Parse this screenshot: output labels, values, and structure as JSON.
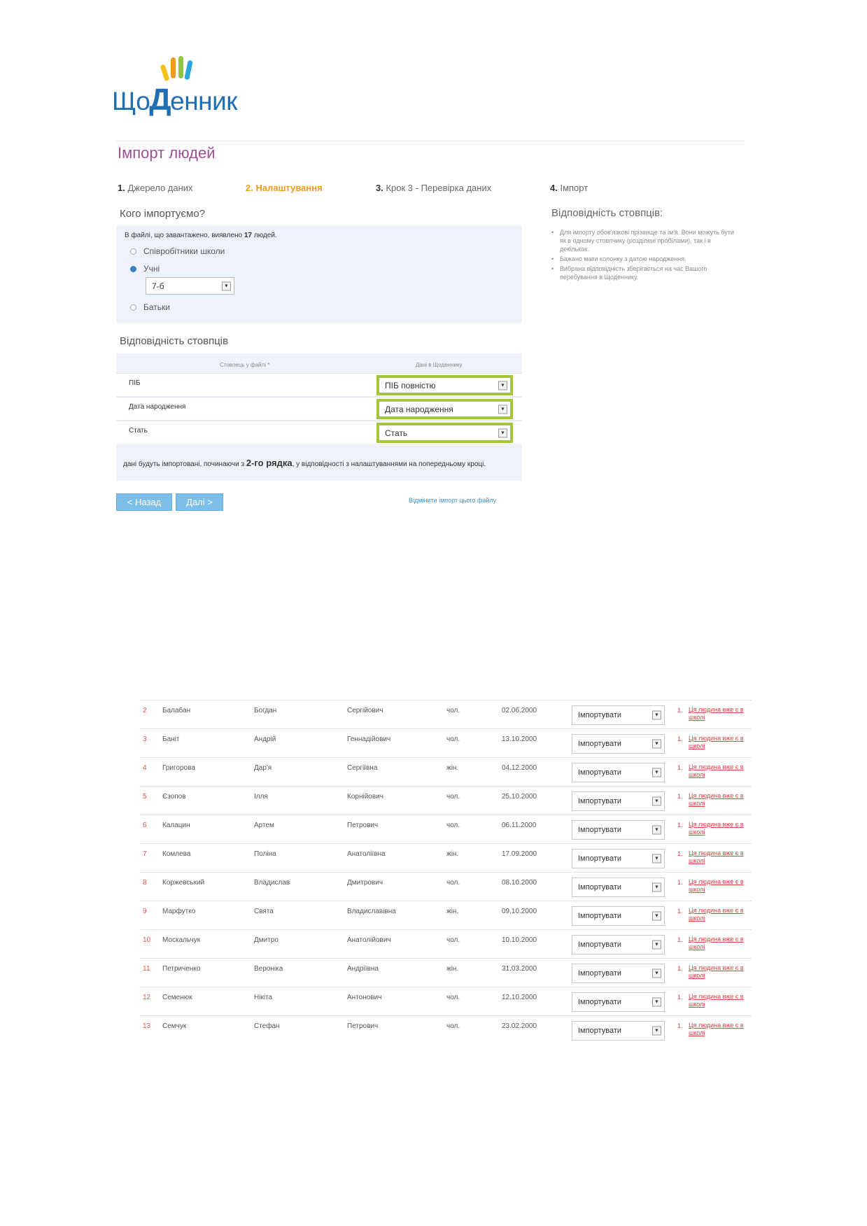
{
  "logo": {
    "prefix": "Що",
    "letter": "Д",
    "suffix": "енник"
  },
  "page_title": "Імпорт людей",
  "steps": [
    {
      "num": "1.",
      "label": "Джерело даних"
    },
    {
      "num": "2.",
      "label": "Налаштування"
    },
    {
      "num": "3.",
      "label": "Крок 3 - Перевірка даних"
    },
    {
      "num": "4.",
      "label": "Імпорт"
    }
  ],
  "who": {
    "title": "Кого імпортуємо?",
    "found_prefix": "В файлі, що завантажено, виявлено",
    "found_count": "17",
    "found_suffix": "людей.",
    "options": [
      "Співробітники школи",
      "Учні",
      "Батьки"
    ],
    "class_select": "7-б"
  },
  "mapping": {
    "title": "Відповідність стовпців",
    "col_file": "Стовпець у файлі *",
    "col_target": "Дані в Щоденнику",
    "rows": [
      {
        "file": "ПІБ",
        "target": "ПІБ повністю"
      },
      {
        "file": "Дата народження",
        "target": "Дата народження"
      },
      {
        "file": "Стать",
        "target": "Стать"
      }
    ],
    "note_prefix": "дані будуть імпортовані, починаючи з",
    "note_row": "2-го рядка",
    "note_suffix": ", у відповідності з налаштуваннями на попередньому кроці."
  },
  "buttons": {
    "back": "< Назад",
    "next": "Далі >"
  },
  "cancel_link": "Відмінити імпорт цього файлу",
  "side": {
    "title": "Відповідність стовпців:",
    "items": [
      "Для імпорту обов'язкові прізвище та ім'я. Вони можуть бути як в одному стовпчику (розділені пробілами), так і в декількох.",
      "Бажано мати колонку з датою народження.",
      "Вибрана відповідність зберігається на час Вашого перебування в Щоденнику."
    ]
  },
  "table": {
    "action": "Імпортувати",
    "error_num": "1.",
    "error_text": "Ця людина вже є в школі",
    "rows": [
      {
        "idx": "2",
        "last": "Балабан",
        "first": "Богдан",
        "middle": "Сергійович",
        "sex": "чол.",
        "dob": "02.06.2000"
      },
      {
        "idx": "3",
        "last": "Баніт",
        "first": "Андрій",
        "middle": "Геннадійович",
        "sex": "чол.",
        "dob": "13.10.2000"
      },
      {
        "idx": "4",
        "last": "Григорова",
        "first": "Дар'я",
        "middle": "Сергіївна",
        "sex": "жін.",
        "dob": "04.12.2000"
      },
      {
        "idx": "5",
        "last": "Єзопов",
        "first": "Ілля",
        "middle": "Корнійович",
        "sex": "чол.",
        "dob": "25.10.2000"
      },
      {
        "idx": "6",
        "last": "Калацин",
        "first": "Артем",
        "middle": "Петрович",
        "sex": "чол.",
        "dob": "06.11.2000"
      },
      {
        "idx": "7",
        "last": "Комлева",
        "first": "Поліна",
        "middle": "Анатоліївна",
        "sex": "жін.",
        "dob": "17.09.2000"
      },
      {
        "idx": "8",
        "last": "Коржевський",
        "first": "Владислав",
        "middle": "Дмитрович",
        "sex": "чол.",
        "dob": "08.10.2000"
      },
      {
        "idx": "9",
        "last": "Марфутко",
        "first": "Свята",
        "middle": "Владиславівна",
        "sex": "жін.",
        "dob": "09.10.2000"
      },
      {
        "idx": "10",
        "last": "Москальчук",
        "first": "Дмитро",
        "middle": "Анатолійович",
        "sex": "чол.",
        "dob": "10.10.2000"
      },
      {
        "idx": "11",
        "last": "Петриченко",
        "first": "Вероніка",
        "middle": "Андріївна",
        "sex": "жін.",
        "dob": "31.03.2000"
      },
      {
        "idx": "12",
        "last": "Семенюк",
        "first": "Нікіта",
        "middle": "Антонович",
        "sex": "чол.",
        "dob": "12.10.2000"
      },
      {
        "idx": "13",
        "last": "Семчук",
        "first": "Стефан",
        "middle": "Петрович",
        "sex": "чол.",
        "dob": "23.02.2000"
      }
    ]
  }
}
